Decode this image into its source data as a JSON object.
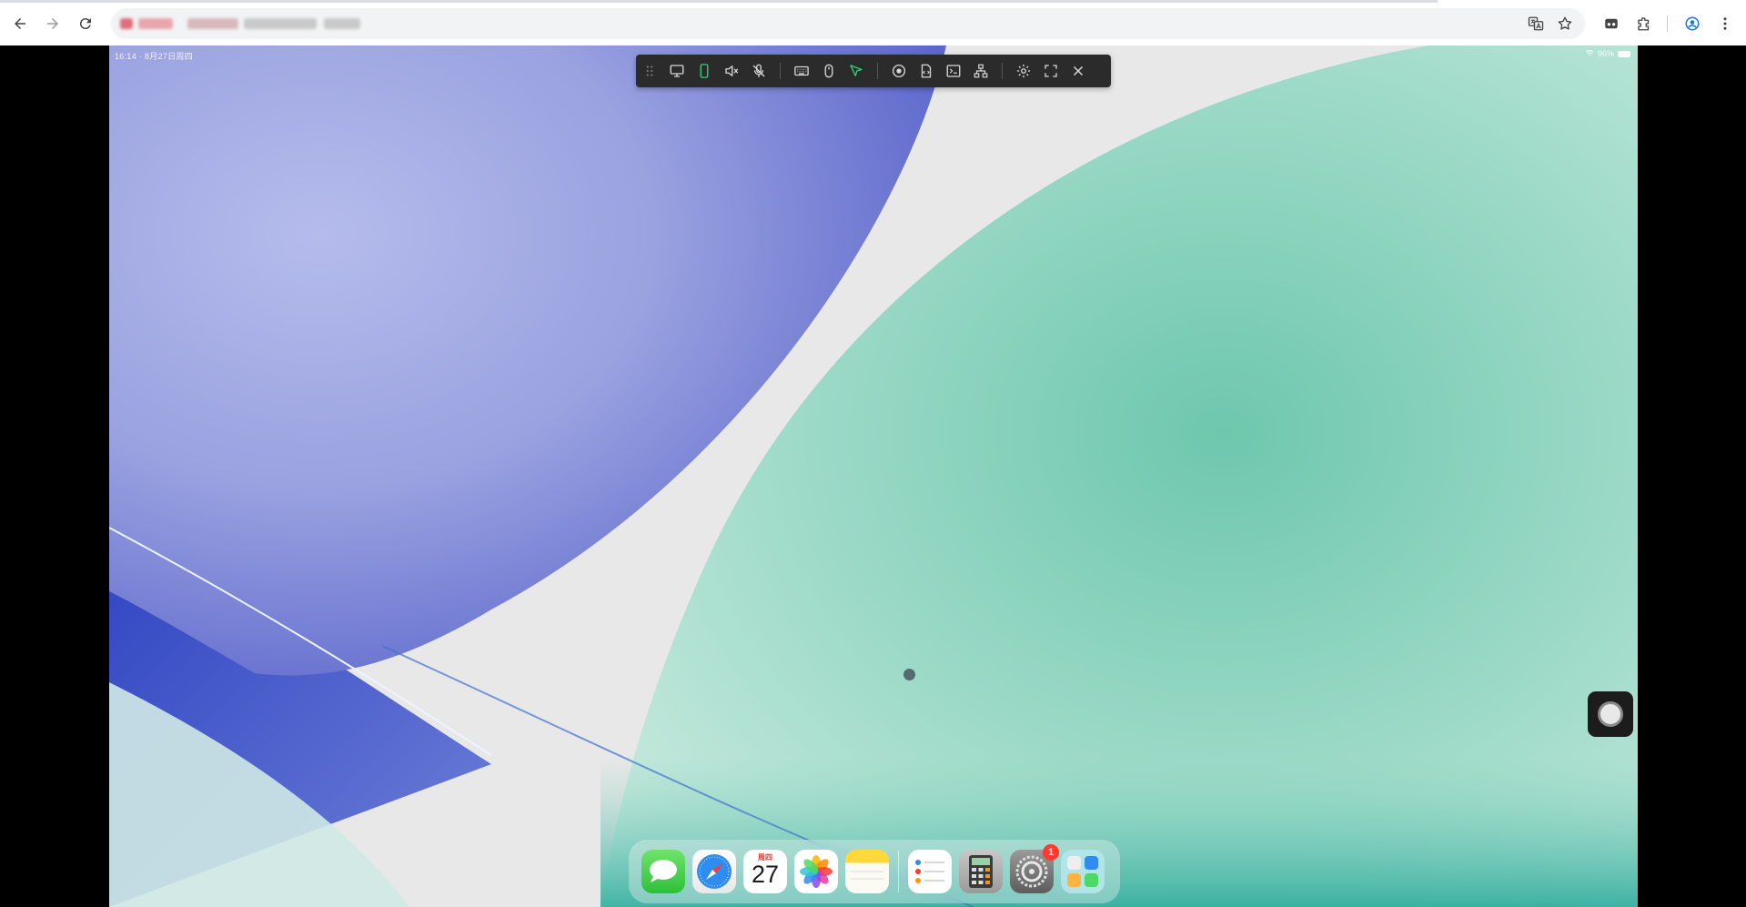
{
  "browser": {
    "nav": {
      "back": "back-icon",
      "forward": "forward-icon",
      "reload": "reload-icon"
    },
    "right_icons": [
      "translate-icon",
      "star-icon",
      "incognito-icon",
      "extensions-icon",
      "profile-icon",
      "more-icon"
    ]
  },
  "device": {
    "status_left": "16:14 · 8月27日周四",
    "status_right": "96%"
  },
  "toolbar": {
    "items": [
      "drag-handle-icon",
      "desktop-icon",
      "phone-icon",
      "mute-icon",
      "mic-off-icon",
      "keyboard-icon",
      "mouse-icon",
      "pointer-icon",
      "record-icon",
      "file-icon",
      "terminal-icon",
      "hierarchy-icon",
      "settings-icon",
      "fullscreen-icon",
      "close-icon"
    ],
    "active_color": "#2fd27a"
  },
  "dock": {
    "calendar_day": "周四",
    "calendar_date": "27",
    "settings_badge": "1",
    "apps": [
      "messages",
      "safari",
      "calendar",
      "photos",
      "notes",
      "reminders",
      "calculator",
      "settings",
      "app-library"
    ]
  },
  "colors": {
    "wallpaper_blue": "#8e97dc",
    "wallpaper_green": "#7fcfb8",
    "wallpaper_white": "#ececec"
  }
}
